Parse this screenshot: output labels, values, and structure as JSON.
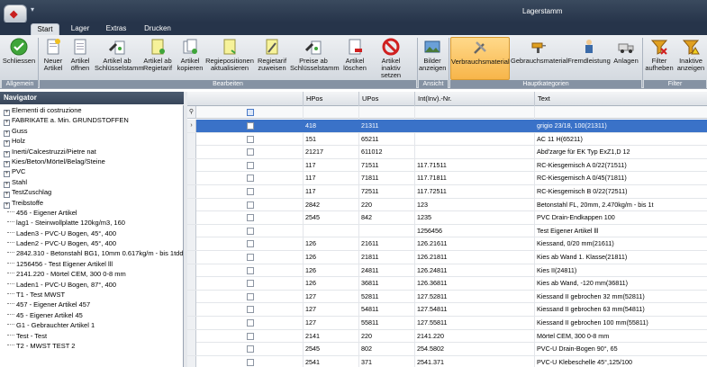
{
  "window": {
    "title": "Lagerstamm"
  },
  "tabs": [
    "Start",
    "Lager",
    "Extras",
    "Drucken"
  ],
  "ribbon": {
    "buttons": [
      {
        "label": "Schliessen",
        "icon": "check-icon"
      },
      {
        "label": "Neuer Artikel",
        "icon": "new-doc-icon"
      },
      {
        "label": "Artikel öffnen",
        "icon": "open-doc-icon"
      },
      {
        "label": "Artikel ab Schlüsselstamm",
        "icon": "key-doc-icon"
      },
      {
        "label": "Artikel ab Regietarif",
        "icon": "tariff-doc-icon"
      },
      {
        "label": "Artikel kopieren",
        "icon": "copy-doc-icon"
      },
      {
        "label": "Regiepositionen aktualisieren",
        "icon": "refresh-doc-icon"
      },
      {
        "label": "Regietarif zuweisen",
        "icon": "assign-doc-icon"
      },
      {
        "label": "Preise ab Schlüsselstamm",
        "icon": "price-key-icon"
      },
      {
        "label": "Artikel löschen",
        "icon": "delete-doc-icon"
      },
      {
        "label": "Artikel inaktiv setzen",
        "icon": "inactive-icon"
      },
      {
        "label": "Bilder anzeigen",
        "icon": "image-icon"
      },
      {
        "label": "Verbrauchsmaterial",
        "icon": "tools-icon"
      },
      {
        "label": "Gebrauchsmaterial",
        "icon": "drill-icon"
      },
      {
        "label": "Fremdleistung",
        "icon": "worker-icon"
      },
      {
        "label": "Anlagen",
        "icon": "truck-icon"
      },
      {
        "label": "Filter aufheben",
        "icon": "filter-clear-icon"
      },
      {
        "label": "Inaktive anzeigen",
        "icon": "filter-warning-icon"
      }
    ],
    "groups": [
      "Allgemein",
      "Bearbeiten",
      "Ansicht",
      "Hauptkategorien",
      "Filter"
    ]
  },
  "navigator": {
    "title": "Navigator",
    "folders": [
      "Elementi di costruzione",
      "FABRIKATE a. Min. GRUNDSTOFFEN",
      "Guss",
      "Holz",
      "Inerti/Calcestruzzi/Pietre nat",
      "Kies/Beton/Mörtel/Belag/Steine",
      "PVC",
      "Stahl",
      "TestZuschlag",
      "Treibstoffe"
    ],
    "items": [
      "456 - Eigener Artikel",
      "lag1 - Steinwollplatte  120kg/m3, 160",
      "Laden3 - PVC-U Bogen, 45°, 400",
      "Laden2 - PVC-U Bogen, 45°, 400",
      "2842.310 - Betonstahl BG1, 10mm 0.617kg/m - bis 1tdd",
      "1256456 - Test Eigener Artikel lll",
      "2141.220 - Mörtel CEM, 300 0-8 mm",
      "Laden1 - PVC-U Bogen, 87°, 400",
      "T1 - Test MWST",
      "457 - Eigener Artikel 457",
      "45 - Eigener Artikel 45",
      "G1 - Gebrauchter Artikel 1",
      "Test - Test",
      "T2 - MWST TEST 2"
    ]
  },
  "grid": {
    "columns": [
      "HPos",
      "UPos",
      "Int(Inv).-Nr.",
      "Text"
    ],
    "rows": [
      [
        "418",
        "21311",
        "",
        "grigio 23/18, 100(21311)"
      ],
      [
        "151",
        "65211",
        "",
        "AC 11 H(65211)"
      ],
      [
        "21217",
        "611012",
        "",
        "Abd'zarge für EK Typ ExZ1,D 12"
      ],
      [
        "117",
        "71511",
        "117.71511",
        "RC-Kiesgemisch A 0/22(71511)"
      ],
      [
        "117",
        "71811",
        "117.71811",
        "RC-Kiesgemisch A 0/45(71811)"
      ],
      [
        "117",
        "72511",
        "117.72511",
        "RC-Kiesgemisch B 0/22(72511)"
      ],
      [
        "2842",
        "220",
        "123",
        "Betonstahl FL, 20mm, 2.470kg/m - bis 1t"
      ],
      [
        "2545",
        "842",
        "1235",
        "PVC Drain-Endkappen 100"
      ],
      [
        "",
        "",
        "1256456",
        "Test Eigener Artikel lll"
      ],
      [
        "126",
        "21611",
        "126.21611",
        "Kiessand, 0/20 mm(21611)"
      ],
      [
        "126",
        "21811",
        "126.21811",
        "Kies ab Wand 1. Klasse(21811)"
      ],
      [
        "126",
        "24811",
        "126.24811",
        "Kies II(24811)"
      ],
      [
        "126",
        "36811",
        "126.36811",
        "Kies ab Wand, -120 mm(36811)"
      ],
      [
        "127",
        "52811",
        "127.52811",
        "Kiessand II gebrochen  32 mm(52811)"
      ],
      [
        "127",
        "54811",
        "127.54811",
        "Kiessand II gebrochen  63 mm(54811)"
      ],
      [
        "127",
        "55811",
        "127.55811",
        "Kiessand II gebrochen 100 mm(55811)"
      ],
      [
        "2141",
        "220",
        "2141.220",
        "Mörtel CEM, 300 0-8 mm"
      ],
      [
        "2545",
        "802",
        "254.5802",
        "PVC-U Drain-Bogen 90°,  65"
      ],
      [
        "2541",
        "371",
        "2541.371",
        "PVC-U Klebeschelle 45°,125/100"
      ]
    ]
  }
}
